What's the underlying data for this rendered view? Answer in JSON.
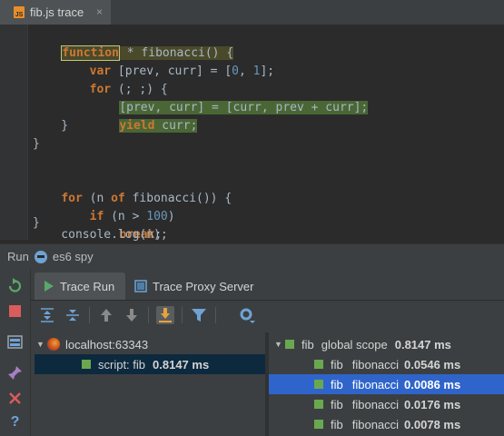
{
  "editor_tab": {
    "icon": "js-file-icon",
    "badge": "JS",
    "title": "fib.js trace",
    "close": "×"
  },
  "code": {
    "l1a": "function",
    "l1b": " * fibonacci() {",
    "l2a": "    var",
    "l2b": " [prev, curr] = [",
    "l2c": "0",
    "l2d": ", ",
    "l2e": "1",
    "l2f": "];",
    "l3a": "    for",
    "l3b": " (; ;) {",
    "l4": "[prev, curr] = [curr, prev + curr];",
    "l5a": "yield",
    "l5b": " curr;",
    "l6": "    }",
    "l7": "}",
    "l9a": "for",
    "l9b": " (n ",
    "l9c": "of",
    "l9d": " fibonacci()) {",
    "l10a": "    if",
    "l10b": " (n > ",
    "l10c": "100",
    "l10d": ")",
    "l11a": "break",
    "l11b": ";",
    "l12": "    console.log(n);",
    "l13": "}"
  },
  "run_bar": {
    "label": "Run",
    "config": "es6 spy"
  },
  "panel_tabs": {
    "trace_run": "Trace Run",
    "trace_proxy": "Trace Proxy Server"
  },
  "tree": {
    "host": "localhost:63343",
    "script_label": "script: fib",
    "script_time": "0.8147 ms"
  },
  "stack": [
    {
      "name": "fib",
      "scope": "global scope",
      "time": "0.8147 ms"
    },
    {
      "name": "fib",
      "scope": "fibonacci",
      "time": "0.0546 ms"
    },
    {
      "name": "fib",
      "scope": "fibonacci",
      "time": "0.0086 ms"
    },
    {
      "name": "fib",
      "scope": "fibonacci",
      "time": "0.0176 ms"
    },
    {
      "name": "fib",
      "scope": "fibonacci",
      "time": "0.0078 ms"
    }
  ],
  "colors": {
    "keyword": "#cc7832",
    "number": "#6897bb",
    "selection": "#2f65ca",
    "green_marker": "#6aa84f"
  }
}
